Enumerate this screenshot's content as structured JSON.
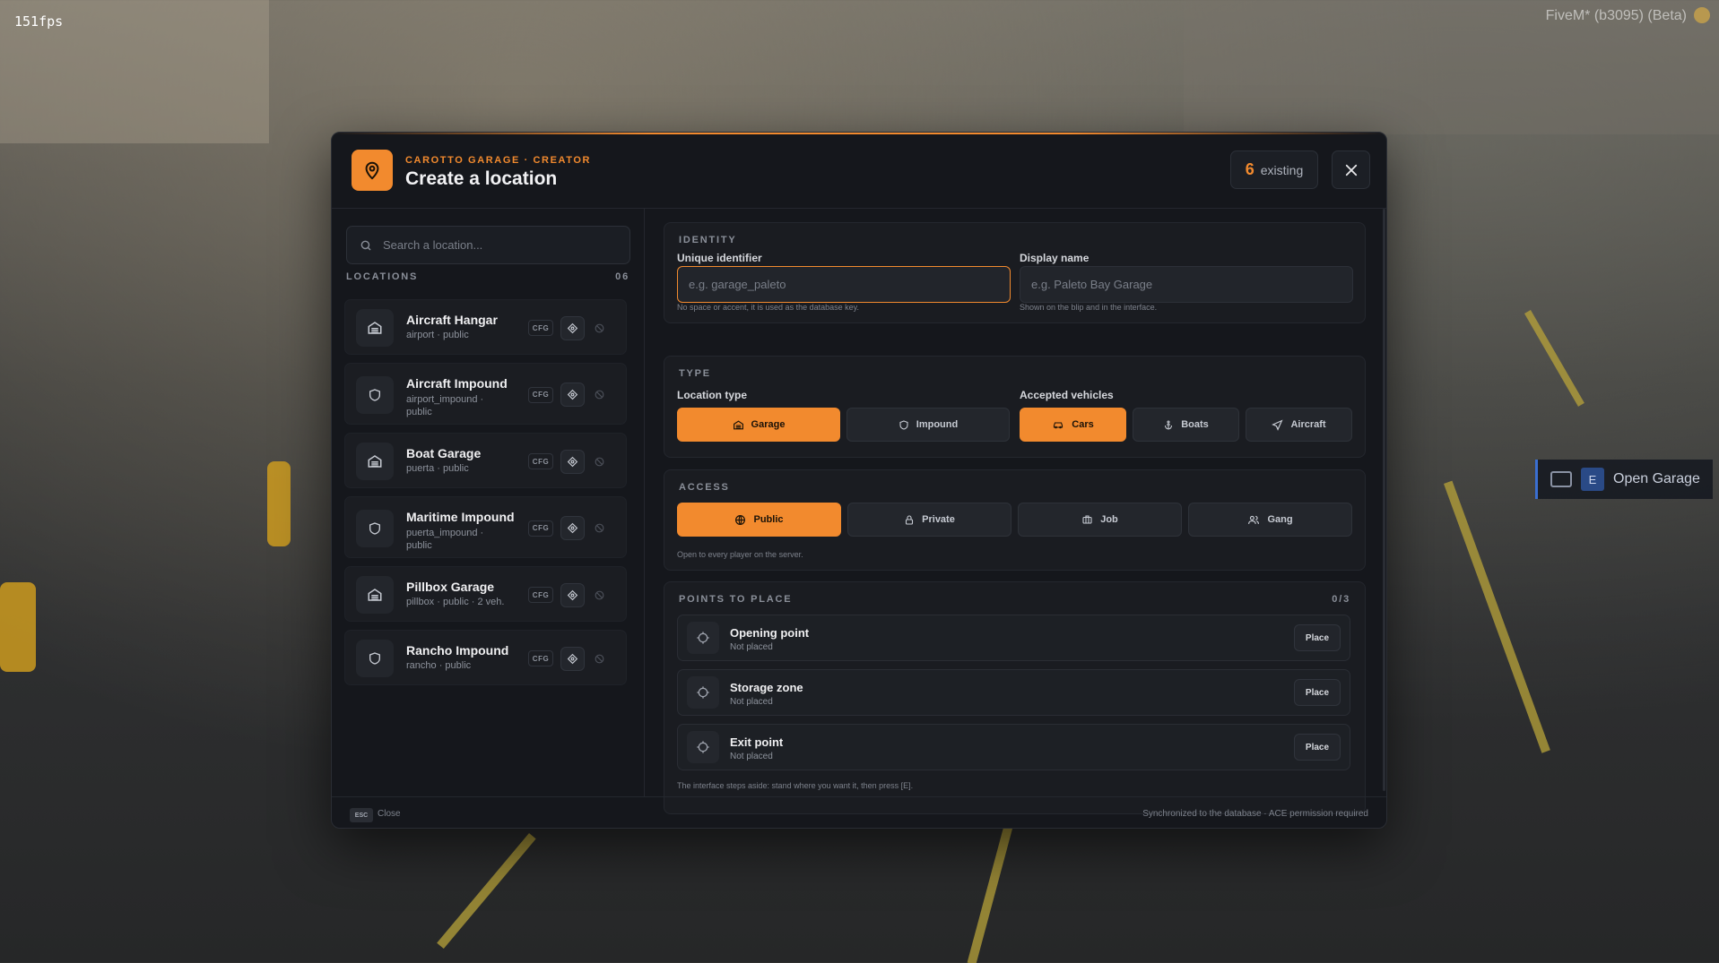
{
  "hud": {
    "fps": "151fps",
    "build": "FiveM* (b3095) (Beta)"
  },
  "prompt": {
    "key": "E",
    "label": "Open Garage"
  },
  "header": {
    "eyebrow": "CAROTTO GARAGE · CREATOR",
    "title": "Create a location",
    "existing_count": "6",
    "existing_label": "existing"
  },
  "sidebar": {
    "search_placeholder": "Search a location...",
    "section_label": "LOCATIONS",
    "section_count": "06",
    "items": [
      {
        "name": "Aircraft Hangar",
        "meta": "airport · public",
        "icon": "garage-icon",
        "cfg": "CFG"
      },
      {
        "name": "Aircraft Impound",
        "meta": "airport_impound · public",
        "icon": "shield-icon",
        "cfg": "CFG"
      },
      {
        "name": "Boat Garage",
        "meta": "puerta · public",
        "icon": "garage-icon",
        "cfg": "CFG"
      },
      {
        "name": "Maritime Impound",
        "meta": "puerta_impound · public",
        "icon": "shield-icon",
        "cfg": "CFG"
      },
      {
        "name": "Pillbox Garage",
        "meta": "pillbox · public · 2 veh.",
        "icon": "garage-icon",
        "cfg": "CFG"
      },
      {
        "name": "Rancho Impound",
        "meta": "rancho · public",
        "icon": "shield-icon",
        "cfg": "CFG"
      }
    ]
  },
  "identity": {
    "title": "IDENTITY",
    "uid_label": "Unique identifier",
    "uid_placeholder": "e.g. garage_paleto",
    "uid_hint": "No space or accent, it is used as the database key.",
    "display_label": "Display name",
    "display_placeholder": "e.g. Paleto Bay Garage",
    "display_hint": "Shown on the blip and in the interface."
  },
  "type": {
    "title": "TYPE",
    "location_label": "Location type",
    "location_options": [
      "Garage",
      "Impound"
    ],
    "location_selected": "Garage",
    "vehicles_label": "Accepted vehicles",
    "vehicle_options": [
      "Cars",
      "Boats",
      "Aircraft"
    ],
    "vehicles_selected": [
      "Cars"
    ]
  },
  "access": {
    "title": "ACCESS",
    "options": [
      "Public",
      "Private",
      "Job",
      "Gang"
    ],
    "selected": "Public",
    "hint": "Open to every player on the server."
  },
  "points": {
    "title": "POINTS TO PLACE",
    "progress": "0/3",
    "items": [
      {
        "name": "Opening point",
        "status": "Not placed",
        "button": "Place"
      },
      {
        "name": "Storage zone",
        "status": "Not placed",
        "button": "Place"
      },
      {
        "name": "Exit point",
        "status": "Not placed",
        "button": "Place"
      }
    ],
    "hint": "The interface steps aside: stand where you want it, then press [E]."
  },
  "footer": {
    "esc_key": "ESC",
    "esc_label": "Close",
    "note": "Synchronized to the database · ACE permission required"
  },
  "colors": {
    "accent": "#f28a2e",
    "panel": "#15171c",
    "card": "#1a1c21"
  }
}
